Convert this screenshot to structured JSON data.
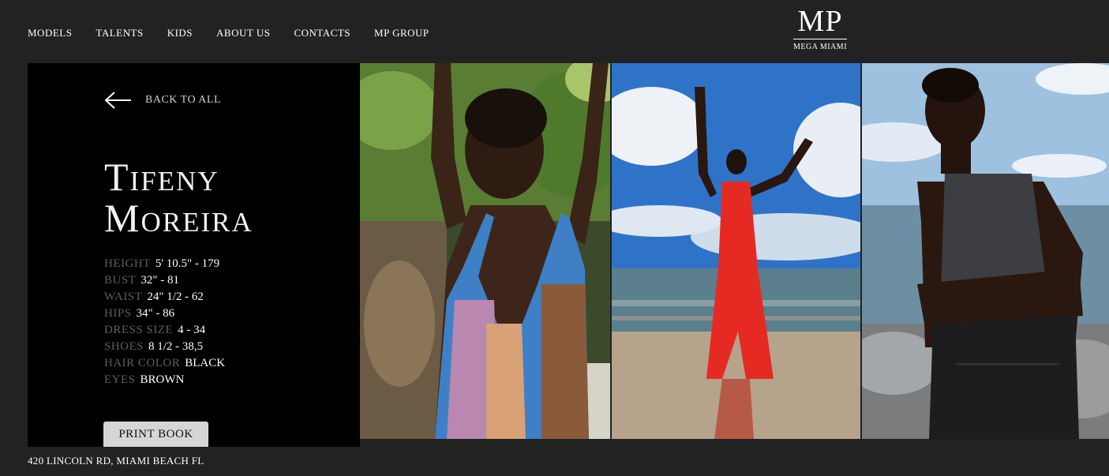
{
  "nav": {
    "items": [
      {
        "label": "MODELS"
      },
      {
        "label": "TALENTS"
      },
      {
        "label": "KIDS"
      },
      {
        "label": "ABOUT US"
      },
      {
        "label": "CONTACTS"
      },
      {
        "label": "MP GROUP"
      }
    ]
  },
  "logo": {
    "mark": "MP",
    "sub": "MEGA MIAMI"
  },
  "back": {
    "label": "BACK TO ALL",
    "icon": "arrow-left-icon"
  },
  "model": {
    "first_name": "Tifeny",
    "last_name": "Moreira",
    "stats": [
      {
        "label": "HEIGHT",
        "value": "5' 10.5\" - 179"
      },
      {
        "label": "BUST",
        "value": "32\" - 81"
      },
      {
        "label": "WAIST",
        "value": "24\" 1/2 - 62"
      },
      {
        "label": "HIPS",
        "value": "34\" - 86"
      },
      {
        "label": "DRESS SIZE",
        "value": "4 - 34"
      },
      {
        "label": "SHOES",
        "value": "8 1/2 - 38,5"
      },
      {
        "label": "HAIR COLOR",
        "value": "BLACK"
      },
      {
        "label": "EYES",
        "value": "BROWN"
      }
    ]
  },
  "print_button": {
    "label": "PRINT BOOK"
  },
  "footer": {
    "address": "420 LINCOLN RD, MIAMI BEACH FL"
  },
  "colors": {
    "page_bg": "#222222",
    "panel_bg": "#000000",
    "label_gray": "#5e5e5e",
    "button_bg": "#d6d6d6"
  }
}
